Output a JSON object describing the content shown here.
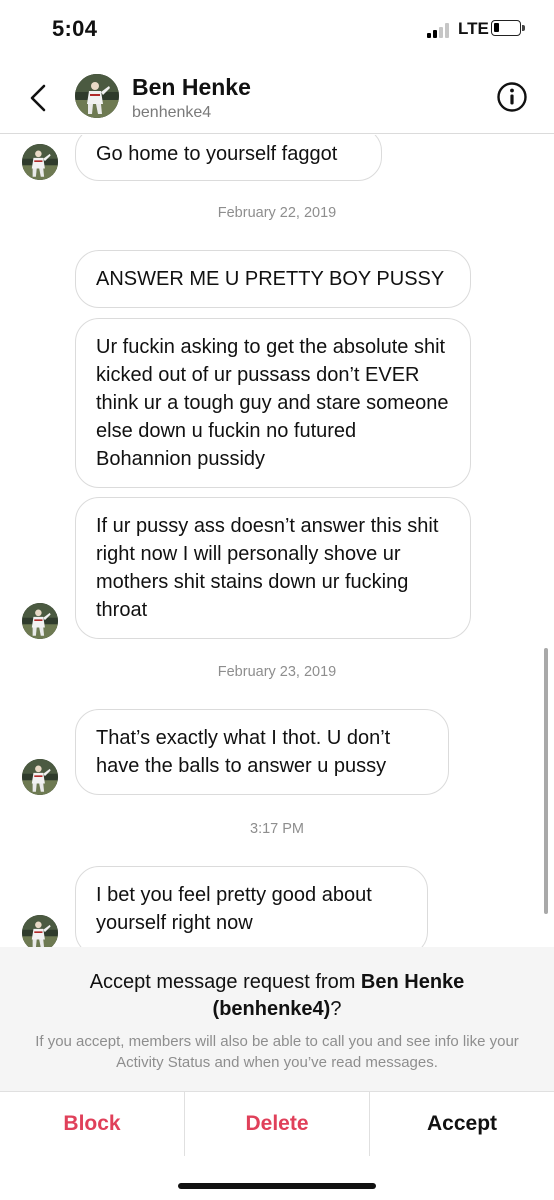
{
  "status_bar": {
    "time": "5:04",
    "network": "LTE",
    "signal_bars": 2,
    "signal_bars_total": 4,
    "battery_level": 0.2
  },
  "header": {
    "name": "Ben Henke",
    "username": "benhenke4",
    "icons": {
      "back": "chevron-left-icon",
      "info": "info-icon"
    }
  },
  "messages": {
    "m0": "Go home to yourself faggot",
    "ts1": "February 22, 2019",
    "m1": "ANSWER ME U PRETTY BOY PUSSY",
    "m2": "Ur fuckin asking to get the absolute shit kicked out of ur pussass don’t EVER think ur a tough guy and stare someone else down u fuckin no futured Bohannion pussidy",
    "m3": "If ur pussy ass doesn’t answer this shit right now I will personally shove ur mothers shit stains down ur fucking throat",
    "ts2": "February 23, 2019",
    "m4": "That’s exactly what I thot. U don’t have the balls to answer u pussy",
    "ts3": "3:17 PM",
    "m5": "I bet you feel pretty good about yourself right now"
  },
  "request": {
    "title_prefix": "Accept message request from ",
    "title_name": "Ben Henke (benhenke4)",
    "title_suffix": "?",
    "description": "If you accept, members will also be able to call you and see info like your Activity Status and when you’ve read messages."
  },
  "actions": {
    "block": "Block",
    "delete": "Delete",
    "accept": "Accept"
  },
  "colors": {
    "destructive": "#e0405a",
    "muted_text": "#8e8e8e",
    "bubble_border": "#dbdbdb",
    "panel_bg": "#f5f5f5"
  }
}
